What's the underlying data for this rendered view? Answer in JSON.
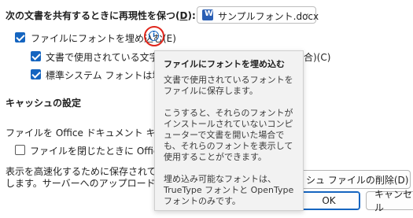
{
  "share": {
    "label": "次の文書を共有するときに再現性を保つ(",
    "key": "D",
    "label_end": "):",
    "file": "サンプルフォント.docx"
  },
  "options": {
    "embed_fonts": "ファイルにフォントを埋め込む(E)",
    "only_used": "文書で使用されている文字だ",
    "only_used_tail": "合)(C)",
    "no_common": "標準システム フォントは埋め込"
  },
  "cache": {
    "heading": "キャッシュの設定",
    "days_label": "ファイルを Office ドキュメント キャッシュ",
    "delete_on_close": "ファイルを閉じたときに Office ドキ",
    "desc1": "表示を高速化するために保存されてい",
    "desc2": "します。サーバーへのアップロードを保留",
    "delete_button": "シュ ファイルの削除(D)"
  },
  "buttons": {
    "ok": "OK",
    "cancel": "キャンセル"
  },
  "tooltip": {
    "title": "ファイルにフォントを埋め込む",
    "p1": "文書で使用されているフォントをファイルに保存します。",
    "p2": "こうすると、それらのフォントがインストールされていないコンピューターで文書を開いた場合でも、それらのフォントを表示して使用することができます。",
    "p3": "埋め込み可能なフォントは、TrueType フォントと OpenType フォントのみです。"
  },
  "colors": {
    "accent": "#1565c0",
    "highlight_circle": "#e0251b"
  }
}
